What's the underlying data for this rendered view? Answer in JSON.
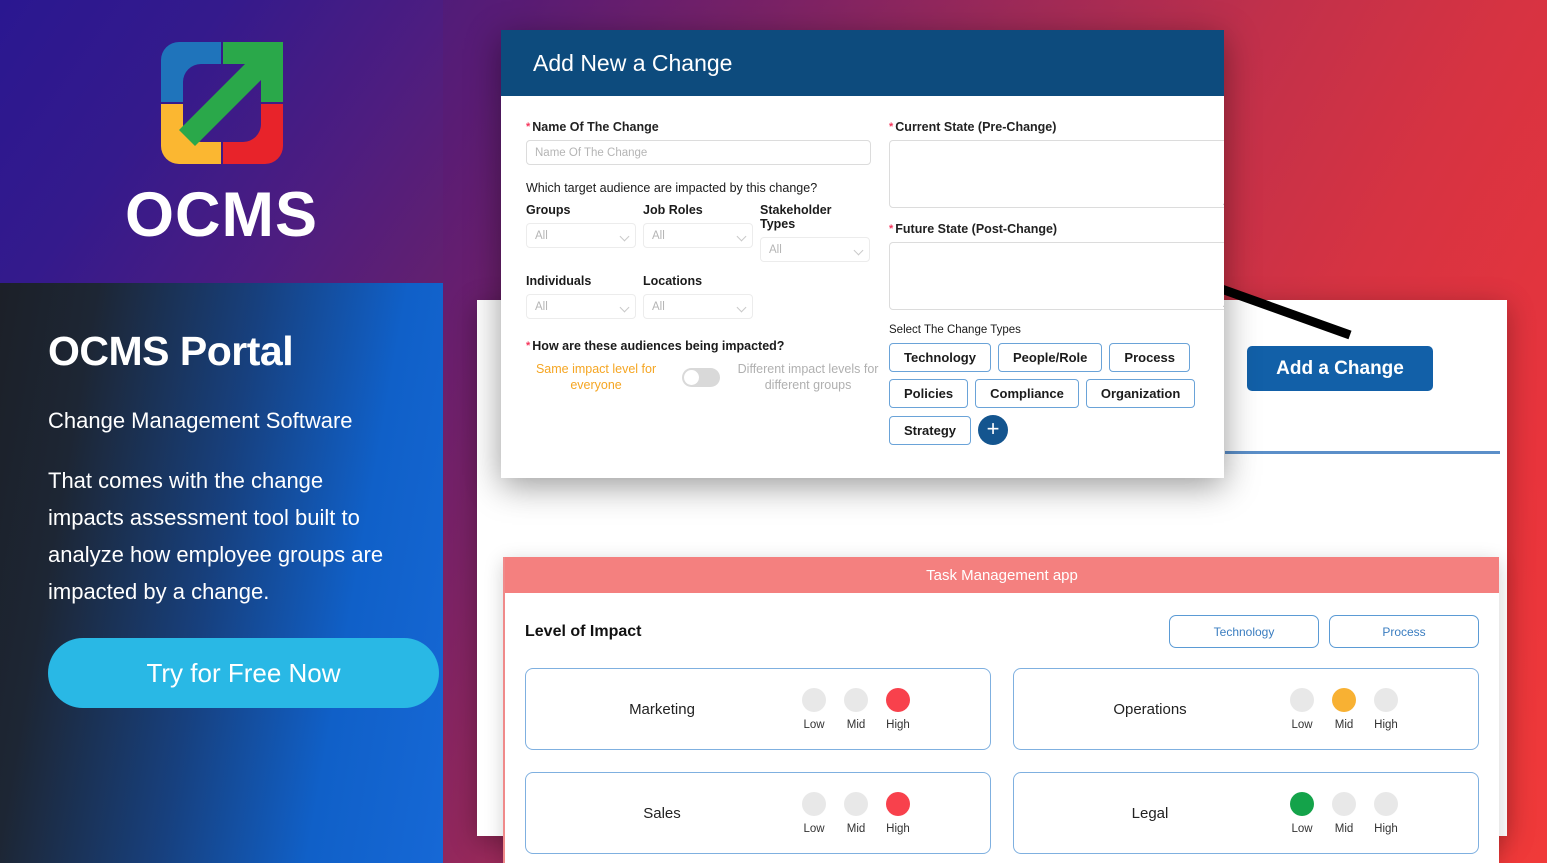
{
  "promo": {
    "brand": "OCMS",
    "logo_icon": "expand-arrow-logo",
    "title": "OCMS Portal",
    "subtitle": "Change Management Software",
    "body": "That comes with the change impacts assessment tool built to analyze how employee groups are impacted by a change.",
    "cta_label": "Try for Free Now"
  },
  "app": {
    "add_change_label": "Add a Change"
  },
  "modal": {
    "title": "Add New a Change",
    "name_field": {
      "label": "Name Of The Change",
      "placeholder": "Name Of The Change",
      "value": "",
      "required": true
    },
    "audience_question": "Which target audience are impacted by this change?",
    "selects": [
      {
        "label": "Groups",
        "value": "All"
      },
      {
        "label": "Job Roles",
        "value": "All"
      },
      {
        "label": "Stakeholder Types",
        "value": "All"
      },
      {
        "label": "Individuals",
        "value": "All"
      },
      {
        "label": "Locations",
        "value": "All"
      }
    ],
    "impact_question": "How are these audiences being impacted?",
    "impact_toggle": {
      "left_label": "Same impact level for everyone",
      "right_label": "Different impact levels for different groups",
      "state": "left"
    },
    "current_state": {
      "label": "Current State (Pre-Change)",
      "value": "",
      "required": true
    },
    "future_state": {
      "label": "Future State (Post-Change)",
      "value": "",
      "required": true
    },
    "change_types_label": "Select The Change Types",
    "change_types": [
      "Technology",
      "People/Role",
      "Process",
      "Policies",
      "Compliance",
      "Organization",
      "Strategy"
    ],
    "add_type_icon": "plus-icon"
  },
  "task_panel": {
    "header": "Task Management app",
    "impact_title": "Level of Impact",
    "tags": [
      "Technology",
      "Process"
    ],
    "level_labels": [
      "Low",
      "Mid",
      "High"
    ],
    "cards": [
      {
        "name": "Marketing",
        "level": "High"
      },
      {
        "name": "Operations",
        "level": "Mid"
      },
      {
        "name": "Sales",
        "level": "High"
      },
      {
        "name": "Legal",
        "level": "Low"
      }
    ]
  },
  "colors": {
    "modal_header": "#0d4b7d",
    "accent_blue": "#1260a8",
    "toggle_active": "#f5a623",
    "task_header": "#f4807f",
    "level_low": "#14a34a",
    "level_mid": "#f8b133",
    "level_high": "#f8414c",
    "cta": "#29b8e5"
  }
}
